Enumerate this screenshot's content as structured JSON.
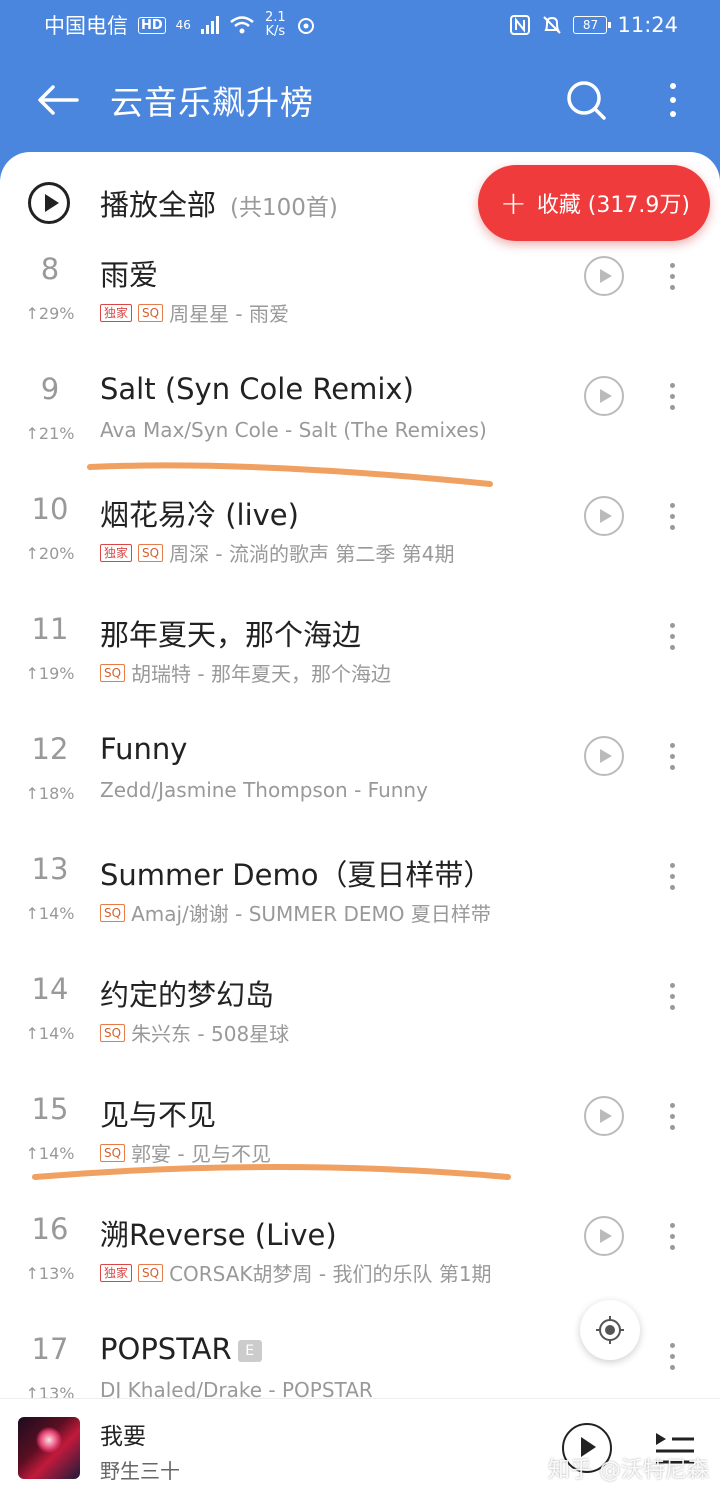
{
  "status_bar": {
    "carrier": "中国电信",
    "hd": "HD",
    "network": "46",
    "speed_value": "2.1",
    "speed_unit": "K/s",
    "battery": "87",
    "time": "11:24"
  },
  "header": {
    "title": "云音乐飙升榜"
  },
  "play_all": {
    "label": "播放全部",
    "count": "(共100首)"
  },
  "collect": {
    "plus": "+",
    "label": "收藏 (317.9万)"
  },
  "badges": {
    "exclusive": "独家",
    "sq": "SQ",
    "explicit": "E"
  },
  "songs": [
    {
      "rank": "8",
      "change": "↑29%",
      "title": "雨爱",
      "meta": "周星星 - 雨爱",
      "exclusive": true,
      "sq": true,
      "playable": true
    },
    {
      "rank": "9",
      "change": "↑21%",
      "title": "Salt (Syn Cole Remix)",
      "meta": "Ava Max/Syn Cole - Salt (The Remixes)",
      "exclusive": false,
      "sq": false,
      "playable": true
    },
    {
      "rank": "10",
      "change": "↑20%",
      "title": "烟花易冷 (live)",
      "meta": "周深 - 流淌的歌声 第二季 第4期",
      "exclusive": true,
      "sq": true,
      "playable": true
    },
    {
      "rank": "11",
      "change": "↑19%",
      "title": "那年夏天，那个海边",
      "meta": "胡瑞特 - 那年夏天，那个海边",
      "exclusive": false,
      "sq": true,
      "playable": false
    },
    {
      "rank": "12",
      "change": "↑18%",
      "title": "Funny",
      "meta": "Zedd/Jasmine Thompson - Funny",
      "exclusive": false,
      "sq": false,
      "playable": true
    },
    {
      "rank": "13",
      "change": "↑14%",
      "title": "Summer Demo（夏日样带）",
      "meta": "Amaj/谢谢 - SUMMER DEMO 夏日样带",
      "exclusive": false,
      "sq": true,
      "playable": false
    },
    {
      "rank": "14",
      "change": "↑14%",
      "title": "约定的梦幻岛",
      "meta": "朱兴东 - 508星球",
      "exclusive": false,
      "sq": true,
      "playable": false
    },
    {
      "rank": "15",
      "change": "↑14%",
      "title": "见与不见",
      "meta": "郭宴 - 见与不见",
      "exclusive": false,
      "sq": true,
      "playable": true
    },
    {
      "rank": "16",
      "change": "↑13%",
      "title": "溯Reverse (Live)",
      "meta": "CORSAK胡梦周 - 我们的乐队 第1期",
      "exclusive": true,
      "sq": true,
      "playable": true
    },
    {
      "rank": "17",
      "change": "↑13%",
      "title": "POPSTAR",
      "meta": "DJ Khaled/Drake - POPSTAR",
      "exclusive": false,
      "sq": false,
      "playable": false,
      "explicit": true
    }
  ],
  "player": {
    "title": "我要",
    "artist": "野生三十"
  },
  "watermark": "知乎 @沃特尼森",
  "colors": {
    "header_bg": "#4a86de",
    "accent_red": "#ef3b3b",
    "annotation_orange": "#f0a060"
  }
}
